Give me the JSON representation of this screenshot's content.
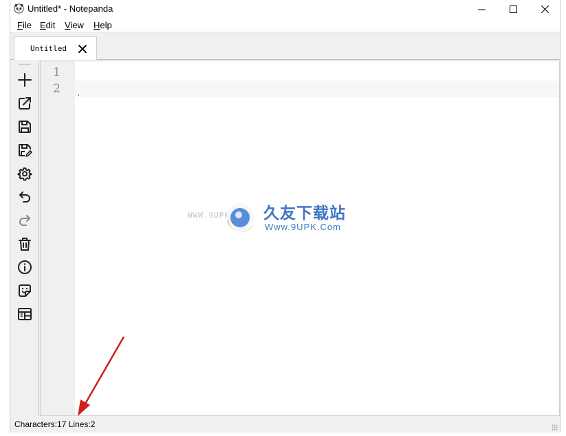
{
  "window": {
    "title": "Untitled* - Notepanda"
  },
  "menu": {
    "items": [
      {
        "u": "F",
        "rest": "ile"
      },
      {
        "u": "E",
        "rest": "dit"
      },
      {
        "u": "V",
        "rest": "iew"
      },
      {
        "u": "H",
        "rest": "elp"
      }
    ]
  },
  "tabs": [
    {
      "label": "Untitled"
    }
  ],
  "toolbar": {
    "icons": [
      "new-icon",
      "open-external-icon",
      "save-icon",
      "save-as-icon",
      "settings-icon",
      "undo-icon",
      "redo-icon",
      "trash-icon",
      "info-icon",
      "sticker-icon",
      "layout-icon"
    ]
  },
  "editor": {
    "line_numbers": [
      "1",
      "2"
    ],
    "current_line": 2
  },
  "watermark": {
    "site": "WWW.9UPK.COM",
    "cn": "久友下载站",
    "url": "Www.9UPK.Com"
  },
  "status": {
    "text": "Characters:17 Lines:2"
  },
  "colors": {
    "arrow": "#cc2020",
    "watermark_blue": "#1d5fb8",
    "logo_orange": "#f5a623"
  }
}
